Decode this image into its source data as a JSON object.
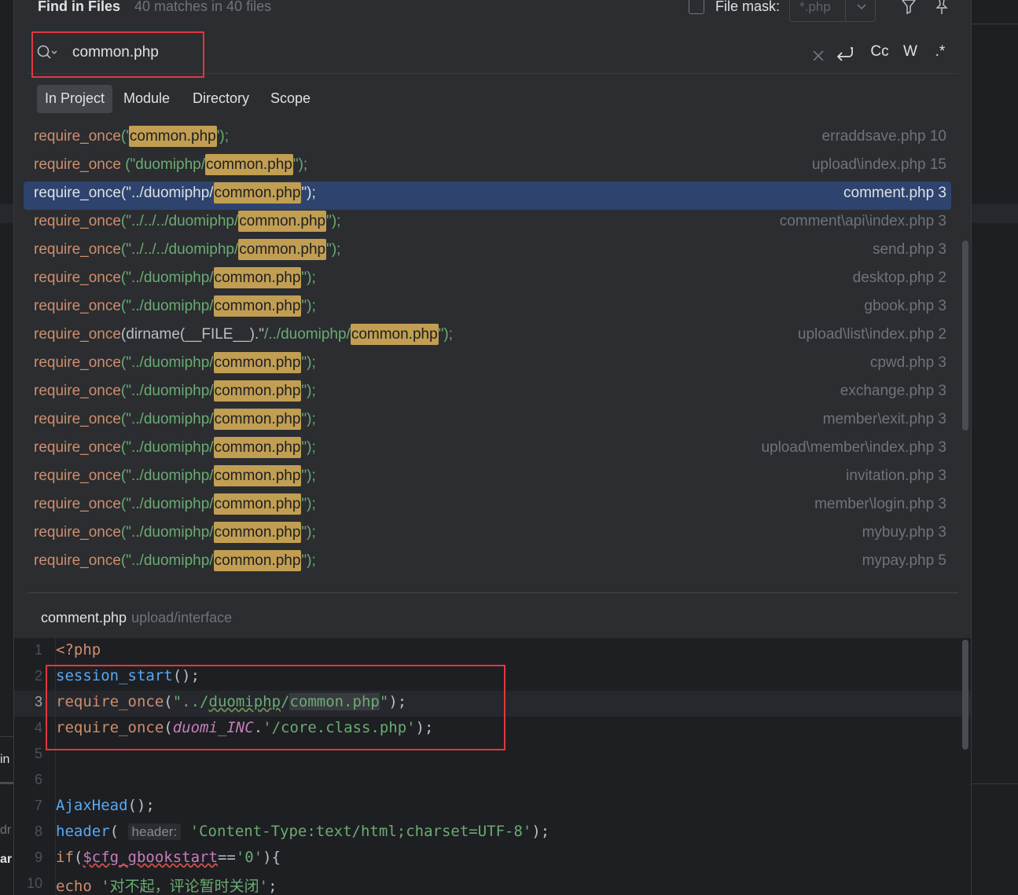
{
  "header": {
    "title": "Find in Files",
    "subtitle": "40 matches in 40 files",
    "file_mask_label": "File mask:",
    "file_mask_value": "*.php"
  },
  "search": {
    "query": "common.php",
    "buttons": [
      "Cc",
      "W",
      ".*"
    ]
  },
  "scopes": [
    {
      "label": "In Project",
      "active": true
    },
    {
      "label": "Module",
      "active": false
    },
    {
      "label": "Directory",
      "active": false
    },
    {
      "label": "Scope",
      "active": false
    }
  ],
  "results": [
    {
      "pre": "require_once('",
      "prefix": "",
      "match": "common.php",
      "post": "');",
      "file": "erraddsave.php 10"
    },
    {
      "pre": "require_once (\"",
      "prefix": "duomiphp/",
      "match": "common.php",
      "post": "\");",
      "file": "upload\\index.php 15"
    },
    {
      "pre": "require_once(\"",
      "prefix": "../duomiphp/",
      "match": "common.php",
      "post": "\");",
      "file": "comment.php 3",
      "selected": true
    },
    {
      "pre": "require_once(\"",
      "prefix": "../../../duomiphp/",
      "match": "common.php",
      "post": "\");",
      "file": "comment\\api\\index.php 3"
    },
    {
      "pre": "require_once(\"",
      "prefix": "../../../duomiphp/",
      "match": "common.php",
      "post": "\");",
      "file": "send.php 3"
    },
    {
      "pre": "require_once(\"",
      "prefix": "../duomiphp/",
      "match": "common.php",
      "post": "\");",
      "file": "desktop.php 2"
    },
    {
      "pre": "require_once(\"",
      "prefix": "../duomiphp/",
      "match": "common.php",
      "post": "\");",
      "file": "gbook.php 3"
    },
    {
      "pre": "require_once(dirname(__FILE__).\"",
      "prefix": "/../duomiphp/",
      "match": "common.php",
      "post": "\");",
      "file": "upload\\list\\index.php 2"
    },
    {
      "pre": "require_once(\"",
      "prefix": "../duomiphp/",
      "match": "common.php",
      "post": "\");",
      "file": "cpwd.php 3"
    },
    {
      "pre": "require_once(\"",
      "prefix": "../duomiphp/",
      "match": "common.php",
      "post": "\");",
      "file": "exchange.php 3"
    },
    {
      "pre": "require_once(\"",
      "prefix": "../duomiphp/",
      "match": "common.php",
      "post": "\");",
      "file": "member\\exit.php 3"
    },
    {
      "pre": "require_once(\"",
      "prefix": "../duomiphp/",
      "match": "common.php",
      "post": "\");",
      "file": "upload\\member\\index.php 3"
    },
    {
      "pre": "require_once(\"",
      "prefix": "../duomiphp/",
      "match": "common.php",
      "post": "\");",
      "file": "invitation.php 3"
    },
    {
      "pre": "require_once(\"",
      "prefix": "../duomiphp/",
      "match": "common.php",
      "post": "\");",
      "file": "member\\login.php 3"
    },
    {
      "pre": "require_once(\"",
      "prefix": "../duomiphp/",
      "match": "common.php",
      "post": "\");",
      "file": "mybuy.php 3"
    },
    {
      "pre": "require_once(\"",
      "prefix": "../duomiphp/",
      "match": "common.php",
      "post": "\");",
      "file": "mypay.php 5"
    }
  ],
  "preview": {
    "file": "comment.php",
    "path": "upload/interface",
    "current_line": 3,
    "line_numbers": [
      "1",
      "2",
      "3",
      "4",
      "5",
      "6",
      "7",
      "8",
      "9",
      "10"
    ],
    "lines": {
      "l1": "<?php",
      "l2_fn": "session_start",
      "l2_rest": "();",
      "l3_kw": "require_once",
      "l3_open": "(",
      "l3_str1": "\"../",
      "l3_str2": "duomiphp",
      "l3_str3": "/",
      "l3_str4": "common.php",
      "l3_str5": "\"",
      "l3_close": ");",
      "l4_kw": "require_once",
      "l4_open": "(",
      "l4_const": "duomi_INC",
      "l4_dot": ".",
      "l4_str": "'/core.class.php'",
      "l4_close": ");",
      "l7_fn": "AjaxHead",
      "l7_rest": "();",
      "l8_fn": "header",
      "l8_open": "( ",
      "l8_hint": "header:",
      "l8_str": "'Content-Type:text/html;charset=UTF-8'",
      "l8_close": ");",
      "l9_kw": "if",
      "l9_open": "(",
      "l9_var": "$cfg_gbookstart",
      "l9_op": "==",
      "l9_str": "'0'",
      "l9_close": "){",
      "l10_kw": "echo",
      "l10_str": "'对不起，评论暂时关闭'",
      "l10_close": ";"
    }
  },
  "background": {
    "frag1": "in",
    "frag2": "dr",
    "frag3": "ar"
  }
}
